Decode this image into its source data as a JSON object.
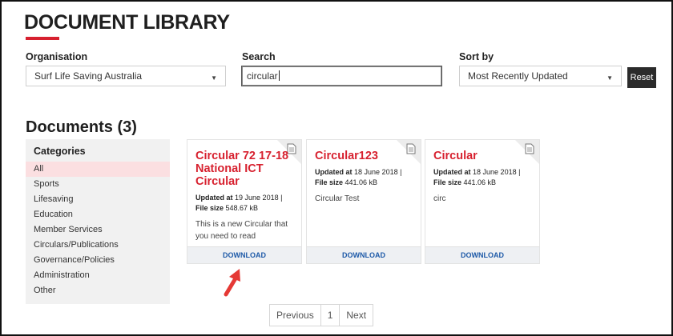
{
  "header": {
    "title": "DOCUMENT LIBRARY"
  },
  "filters": {
    "organisation_label": "Organisation",
    "organisation_value": "Surf Life Saving Australia",
    "search_label": "Search",
    "search_value": "circular",
    "sort_label": "Sort by",
    "sort_value": "Most Recently Updated",
    "reset_label": "Reset"
  },
  "documents": {
    "heading": "Documents (3)",
    "categories_title": "Categories",
    "categories": [
      "All",
      "Sports",
      "Lifesaving",
      "Education",
      "Member Services",
      "Circulars/Publications",
      "Governance/Policies",
      "Administration",
      "Other"
    ],
    "active_category": "All",
    "cards": [
      {
        "title": "Circular 72 17-18 National ICT Circular",
        "updated_label": "Updated at",
        "updated_value": "19 June 2018 |",
        "size_label": "File size",
        "size_value": "548.67 kB",
        "description": "This is a new Circular that you need to read",
        "download": "DOWNLOAD"
      },
      {
        "title": "Circular123",
        "updated_label": "Updated at",
        "updated_value": "18 June 2018 |",
        "size_label": "File size",
        "size_value": "441.06 kB",
        "description": "Circular Test",
        "download": "DOWNLOAD"
      },
      {
        "title": "Circular",
        "updated_label": "Updated at",
        "updated_value": "18 June 2018 |",
        "size_label": "File size",
        "size_value": "441.06 kB",
        "description": "circ",
        "download": "DOWNLOAD"
      }
    ]
  },
  "pagination": {
    "previous": "Previous",
    "page": "1",
    "next": "Next"
  },
  "colors": {
    "accent": "#d7212f",
    "link": "#1e5aa8",
    "active_bg": "#fbdfe1"
  },
  "icons": {
    "card_icon": "document-icon",
    "dropdown": "chevron-down-icon",
    "annotation": "red-arrow"
  }
}
